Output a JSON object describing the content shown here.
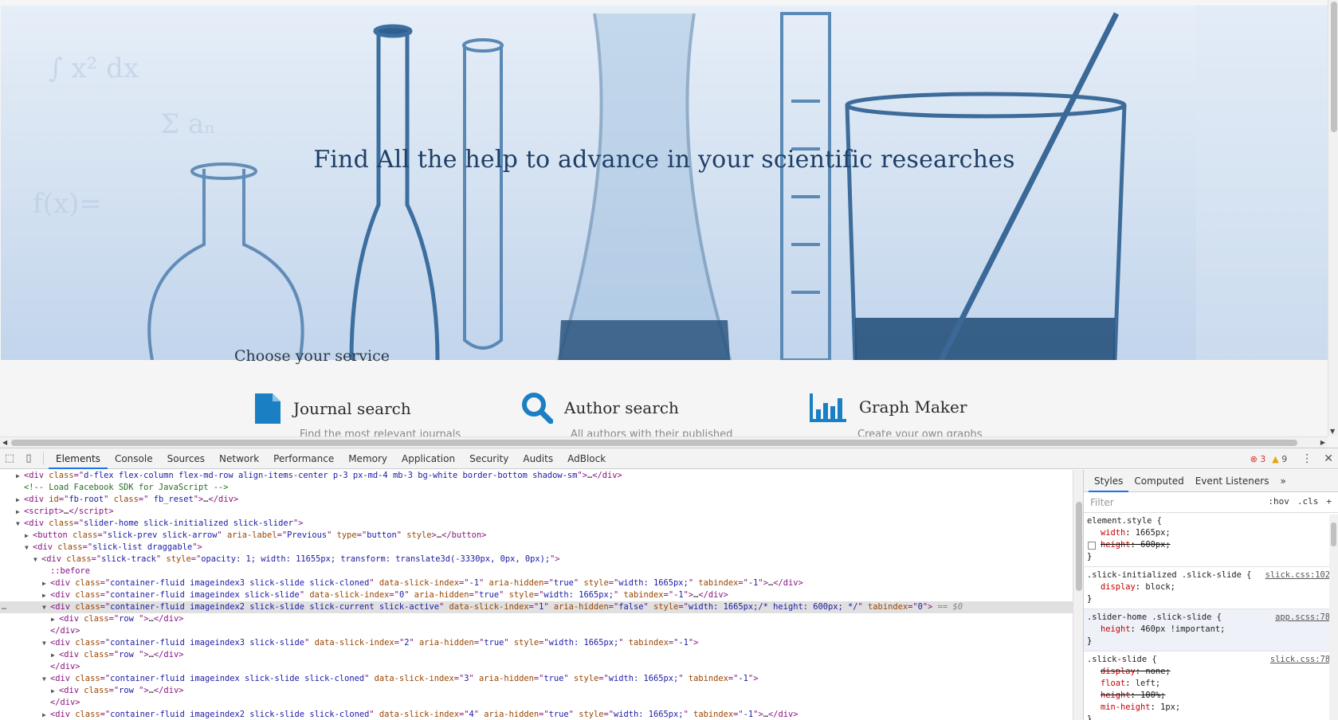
{
  "page": {
    "hero_title": "Find All the help to advance in your scientific researches",
    "choose_service": "Choose your service",
    "services": [
      {
        "label": "Journal search",
        "icon": "document-icon",
        "desc": "Find the most relevant journals"
      },
      {
        "label": "Author search",
        "icon": "search-icon",
        "desc": "All authors with their published"
      },
      {
        "label": "Graph Maker",
        "icon": "bar-chart-icon",
        "desc": "Create your own graphs"
      }
    ],
    "accent_color": "#1b7fc4"
  },
  "devtools": {
    "tabs": [
      "Elements",
      "Console",
      "Sources",
      "Network",
      "Performance",
      "Memory",
      "Application",
      "Security",
      "Audits",
      "AdBlock"
    ],
    "active_tab": "Elements",
    "errors": "3",
    "warnings": "9",
    "styles_tabs": [
      "Styles",
      "Computed",
      "Event Listeners"
    ],
    "filter_placeholder": "Filter",
    "hov": ":hov",
    "cls": ".cls",
    "plus": "+",
    "more": "»",
    "selected_marker": "== $0",
    "dom_lines": [
      {
        "indent": 0,
        "tri": "▶",
        "html": "<span class=\"t-tag\">&lt;div</span> <span class=\"t-attr\">class</span>=\"<span class=\"t-val\">d-flex flex-column flex-md-row align-items-center p-3 px-md-4 mb-3 bg-white border-bottom shadow-sm</span>\"<span class=\"t-tag\">&gt;</span><span class=\"t-text\">…</span><span class=\"t-tag\">&lt;/div&gt;</span>"
      },
      {
        "indent": 0,
        "tri": "",
        "html": "<span class=\"t-comment\">&lt;!-- Load Facebook SDK for JavaScript --&gt;</span>"
      },
      {
        "indent": 0,
        "tri": "▶",
        "html": "<span class=\"t-tag\">&lt;div</span> <span class=\"t-attr\">id</span>=\"<span class=\"t-val\">fb-root</span>\" <span class=\"t-attr\">class</span>=\"<span class=\"t-val\"> fb_reset</span>\"<span class=\"t-tag\">&gt;</span><span class=\"t-text\">…</span><span class=\"t-tag\">&lt;/div&gt;</span>"
      },
      {
        "indent": 0,
        "tri": "▶",
        "html": "<span class=\"t-tag\">&lt;script&gt;</span><span class=\"t-text\">…</span><span class=\"t-tag\">&lt;/script&gt;</span>"
      },
      {
        "indent": 0,
        "tri": "▼",
        "html": "<span class=\"t-tag\">&lt;div</span> <span class=\"t-attr\">class</span>=\"<span class=\"t-val\">slider-home slick-initialized slick-slider</span>\"<span class=\"t-tag\">&gt;</span>"
      },
      {
        "indent": 1,
        "tri": "▶",
        "html": "<span class=\"t-tag\">&lt;button</span> <span class=\"t-attr\">class</span>=\"<span class=\"t-val\">slick-prev slick-arrow</span>\" <span class=\"t-attr\">aria-label</span>=\"<span class=\"t-val\">Previous</span>\" <span class=\"t-attr\">type</span>=\"<span class=\"t-val\">button</span>\" <span class=\"t-attr\">style</span><span class=\"t-tag\">&gt;</span><span class=\"t-text\">…</span><span class=\"t-tag\">&lt;/button&gt;</span>"
      },
      {
        "indent": 1,
        "tri": "▼",
        "html": "<span class=\"t-tag\">&lt;div</span> <span class=\"t-attr\">class</span>=\"<span class=\"t-val\">slick-list draggable</span>\"<span class=\"t-tag\">&gt;</span>"
      },
      {
        "indent": 2,
        "tri": "▼",
        "html": "<span class=\"t-tag\">&lt;div</span> <span class=\"t-attr\">class</span>=\"<span class=\"t-val\">slick-track</span>\" <span class=\"t-attr\">style</span>=\"<span class=\"t-val\">opacity: 1; width: 11655px; transform: translate3d(-3330px, 0px, 0px);</span>\"<span class=\"t-tag\">&gt;</span>"
      },
      {
        "indent": 3,
        "tri": "",
        "html": "<span class=\"t-pseudo\">::before</span>"
      },
      {
        "indent": 3,
        "tri": "▶",
        "html": "<span class=\"t-tag\">&lt;div</span> <span class=\"t-attr\">class</span>=\"<span class=\"t-val\">container-fluid imageindex3 slick-slide slick-cloned</span>\" <span class=\"t-attr\">data-slick-index</span>=\"<span class=\"t-val\">-1</span>\" <span class=\"t-attr\">aria-hidden</span>=\"<span class=\"t-val\">true</span>\" <span class=\"t-attr\">style</span>=\"<span class=\"t-val\">width: 1665px;</span>\" <span class=\"t-attr\">tabindex</span>=\"<span class=\"t-val\">-1</span>\"<span class=\"t-tag\">&gt;</span><span class=\"t-text\">…</span><span class=\"t-tag\">&lt;/div&gt;</span>"
      },
      {
        "indent": 3,
        "tri": "▶",
        "html": "<span class=\"t-tag\">&lt;div</span> <span class=\"t-attr\">class</span>=\"<span class=\"t-val\">container-fluid imageindex slick-slide</span>\" <span class=\"t-attr\">data-slick-index</span>=\"<span class=\"t-val\">0</span>\" <span class=\"t-attr\">aria-hidden</span>=\"<span class=\"t-val\">true</span>\" <span class=\"t-attr\">style</span>=\"<span class=\"t-val\">width: 1665px;</span>\" <span class=\"t-attr\">tabindex</span>=\"<span class=\"t-val\">-1</span>\"<span class=\"t-tag\">&gt;</span><span class=\"t-text\">…</span><span class=\"t-tag\">&lt;/div&gt;</span>"
      },
      {
        "indent": 3,
        "tri": "▼",
        "sel": true,
        "html": "<span class=\"t-tag\">&lt;div</span> <span class=\"t-attr\">class</span>=\"<span class=\"t-val\">container-fluid imageindex2 slick-slide slick-current slick-active</span>\" <span class=\"t-attr\">data-slick-index</span>=\"<span class=\"t-val\">1</span>\" <span class=\"t-attr\">aria-hidden</span>=\"<span class=\"t-val\">false</span>\" <span class=\"t-attr\">style</span>=\"<span class=\"t-val\">width: 1665px;/* height: 600px; */</span>\" <span class=\"t-attr\">tabindex</span>=\"<span class=\"t-val\">0</span>\"<span class=\"t-tag\">&gt;</span> <span class=\"t-dim\">== $0</span>"
      },
      {
        "indent": 4,
        "tri": "▶",
        "html": "<span class=\"t-tag\">&lt;div</span> <span class=\"t-attr\">class</span>=\"<span class=\"t-val\">row </span>\"<span class=\"t-tag\">&gt;</span><span class=\"t-text\">…</span><span class=\"t-tag\">&lt;/div&gt;</span>"
      },
      {
        "indent": 3,
        "tri": "",
        "html": "<span class=\"t-tag\">&lt;/div&gt;</span>"
      },
      {
        "indent": 3,
        "tri": "▼",
        "html": "<span class=\"t-tag\">&lt;div</span> <span class=\"t-attr\">class</span>=\"<span class=\"t-val\">container-fluid imageindex3 slick-slide</span>\" <span class=\"t-attr\">data-slick-index</span>=\"<span class=\"t-val\">2</span>\" <span class=\"t-attr\">aria-hidden</span>=\"<span class=\"t-val\">true</span>\" <span class=\"t-attr\">style</span>=\"<span class=\"t-val\">width: 1665px;</span>\" <span class=\"t-attr\">tabindex</span>=\"<span class=\"t-val\">-1</span>\"<span class=\"t-tag\">&gt;</span>"
      },
      {
        "indent": 4,
        "tri": "▶",
        "html": "<span class=\"t-tag\">&lt;div</span> <span class=\"t-attr\">class</span>=\"<span class=\"t-val\">row </span>\"<span class=\"t-tag\">&gt;</span><span class=\"t-text\">…</span><span class=\"t-tag\">&lt;/div&gt;</span>"
      },
      {
        "indent": 3,
        "tri": "",
        "html": "<span class=\"t-tag\">&lt;/div&gt;</span>"
      },
      {
        "indent": 3,
        "tri": "▼",
        "html": "<span class=\"t-tag\">&lt;div</span> <span class=\"t-attr\">class</span>=\"<span class=\"t-val\">container-fluid imageindex slick-slide slick-cloned</span>\" <span class=\"t-attr\">data-slick-index</span>=\"<span class=\"t-val\">3</span>\" <span class=\"t-attr\">aria-hidden</span>=\"<span class=\"t-val\">true</span>\" <span class=\"t-attr\">style</span>=\"<span class=\"t-val\">width: 1665px;</span>\" <span class=\"t-attr\">tabindex</span>=\"<span class=\"t-val\">-1</span>\"<span class=\"t-tag\">&gt;</span>"
      },
      {
        "indent": 4,
        "tri": "▶",
        "html": "<span class=\"t-tag\">&lt;div</span> <span class=\"t-attr\">class</span>=\"<span class=\"t-val\">row </span>\"<span class=\"t-tag\">&gt;</span><span class=\"t-text\">…</span><span class=\"t-tag\">&lt;/div&gt;</span>"
      },
      {
        "indent": 3,
        "tri": "",
        "html": "<span class=\"t-tag\">&lt;/div&gt;</span>"
      },
      {
        "indent": 3,
        "tri": "▶",
        "html": "<span class=\"t-tag\">&lt;div</span> <span class=\"t-attr\">class</span>=\"<span class=\"t-val\">container-fluid imageindex2 slick-slide slick-cloned</span>\" <span class=\"t-attr\">data-slick-index</span>=\"<span class=\"t-val\">4</span>\" <span class=\"t-attr\">aria-hidden</span>=\"<span class=\"t-val\">true</span>\" <span class=\"t-attr\">style</span>=\"<span class=\"t-val\">width: 1665px;</span>\" <span class=\"t-attr\">tabindex</span>=\"<span class=\"t-val\">-1</span>\"<span class=\"t-tag\">&gt;</span><span class=\"t-text\">…</span><span class=\"t-tag\">&lt;/div&gt;</span>"
      }
    ],
    "style_rules": [
      {
        "selector": "element.style {",
        "src": "",
        "hl": false,
        "decls": [
          {
            "prop": "width",
            "val": "1665px;",
            "strike": false,
            "cb": false
          },
          {
            "prop": "height",
            "val": "600px;",
            "strike": true,
            "cb": true
          }
        ]
      },
      {
        "selector": ".slick-initialized .slick-slide {",
        "src": "slick.css:102",
        "hl": false,
        "decls": [
          {
            "prop": "display",
            "val": "block;",
            "strike": false,
            "cb": false
          }
        ]
      },
      {
        "selector": ".slider-home .slick-slide {",
        "src": "app.scss:78",
        "hl": true,
        "decls": [
          {
            "prop": "height",
            "val": "460px !important;",
            "strike": false,
            "cb": false
          }
        ]
      },
      {
        "selector": ".slick-slide {",
        "src": "slick.css:78",
        "hl": false,
        "decls": [
          {
            "prop": "display",
            "val": "none;",
            "strike": true,
            "cb": false
          },
          {
            "prop": "float",
            "val": "left;",
            "strike": false,
            "cb": false
          },
          {
            "prop": "height",
            "val": "100%;",
            "strike": true,
            "cb": false
          },
          {
            "prop": "min-height",
            "val": "1px;",
            "strike": false,
            "cb": false
          }
        ]
      }
    ]
  }
}
